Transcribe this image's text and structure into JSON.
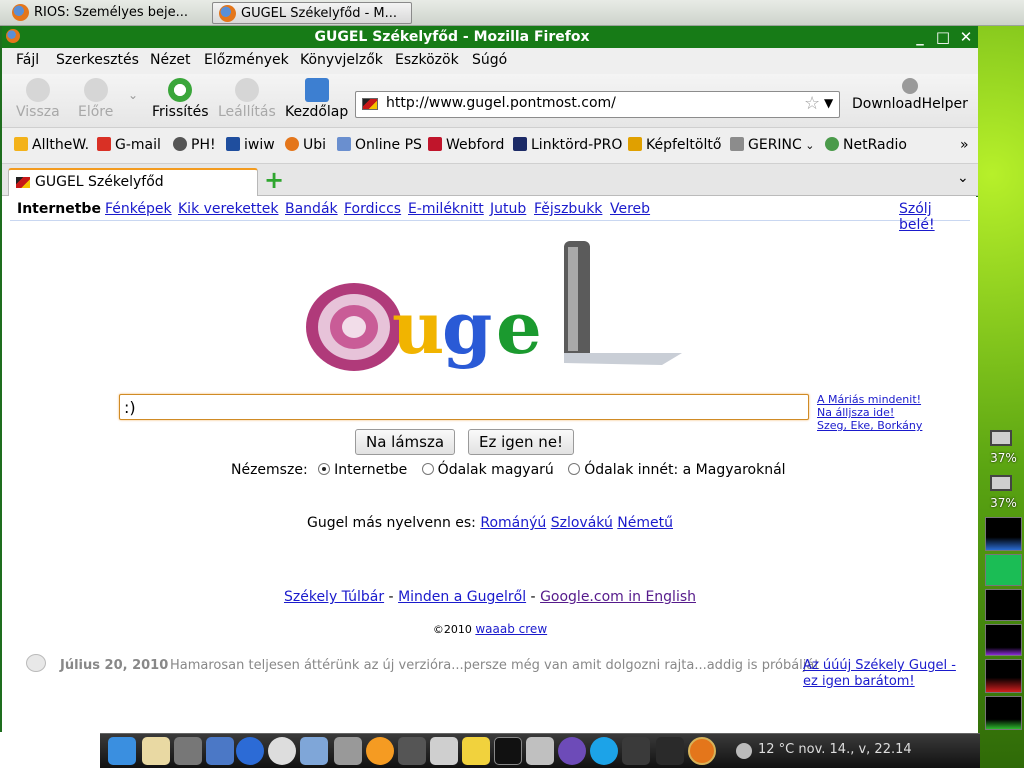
{
  "taskbar": {
    "windows": [
      {
        "label": "RIOS: Személyes beje...",
        "state": "inactive"
      },
      {
        "label": "GUGEL Székelyfőd - M...",
        "state": "active"
      }
    ]
  },
  "window": {
    "title": "GUGEL Székelyfőd - Mozilla Firefox",
    "controls": [
      "_",
      "□",
      "✕"
    ]
  },
  "menu": [
    "Fájl",
    "Szerkesztés",
    "Nézet",
    "Előzmények",
    "Könyvjelzők",
    "Eszközök",
    "Súgó"
  ],
  "nav": {
    "back": "Vissza",
    "forward": "Előre",
    "reload": "Frissítés",
    "stop": "Leállítás",
    "home": "Kezdőlap",
    "url": "http://www.gugel.pontmost.com/",
    "download_helper": "DownloadHelper"
  },
  "bookmarks": [
    "AlltheW.",
    "G-mail",
    "PH!",
    "iwiw",
    "Ubi",
    "Online PS",
    "Webford",
    "Linktörd-PRO",
    "Képfeltöltő",
    "GERINC",
    "NetRadio"
  ],
  "bookmarks_overflow": "»",
  "tab": {
    "label": "GUGEL Székelyfőd",
    "new_tab": "+",
    "list": "⌄"
  },
  "gbar": {
    "active": "Internetbe",
    "links": [
      "Fénképek",
      "Kik verekettek",
      "Bandák",
      "Fordiccs",
      "E-miléknitt",
      "Jutub",
      "Fějszbukk",
      "Vereb"
    ],
    "signin": "Szólj belé!"
  },
  "logo": {
    "text": "Gugel"
  },
  "search": {
    "value": ":)",
    "side_links": [
      "A Máriás mindenit!",
      "Na álljsza ide!",
      "Szeg, Eke, Borkány"
    ],
    "button_search": "Na lámsza",
    "button_lucky": "Ez igen ne!"
  },
  "view": {
    "label": "Nézemsze:",
    "options": [
      "Internetbe",
      "Ódalak magyarú",
      "Ódalak innét: a Magyaroknál"
    ],
    "selected": 0
  },
  "languages": {
    "prefix": "Gugel más nyelvenn es:",
    "items": [
      "Románýú",
      "Szlovákú",
      "Németű"
    ]
  },
  "footer": {
    "links": [
      "Székely Túlbár",
      "Minden a Gugelről",
      "Google.com in English"
    ],
    "sep": "-",
    "copyright": "©2010",
    "copyright_link": "waaab crew"
  },
  "news": {
    "date": "Július 20, 2010",
    "text": "Hamarosan teljesen áttérünk az új verzióra...persze még van amit dolgozni rajta...addig is próbáljátok ki",
    "link": "Az úúúj Székely Gugel - ez igen barátom!"
  },
  "panel": {
    "battery1": "37%",
    "battery2": "37%"
  },
  "dock": {
    "status": "12 °C nov. 14., v, 22.14"
  },
  "colors": {
    "title_green": "#177b17",
    "link_blue": "#1a1acc",
    "visited": "#551a8b",
    "focus_orange": "#d08b25"
  }
}
